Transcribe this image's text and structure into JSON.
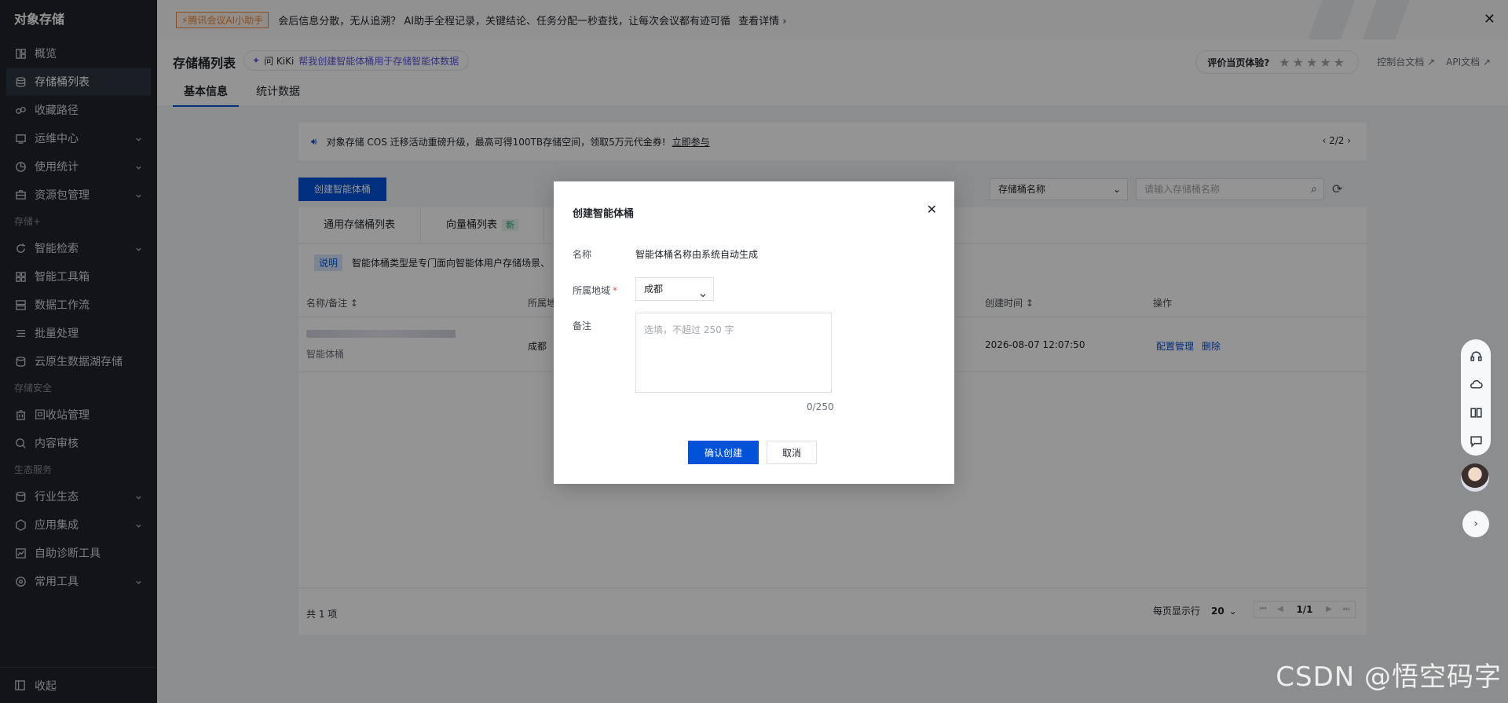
{
  "sidebar": {
    "brand": "对象存储",
    "items": [
      {
        "label": "概览",
        "icon": "overview-icon",
        "chevron": false
      },
      {
        "label": "存储桶列表",
        "icon": "bucket-icon",
        "chevron": false,
        "active": true
      },
      {
        "label": "收藏路径",
        "icon": "link-icon",
        "chevron": false
      },
      {
        "label": "运维中心",
        "icon": "monitor-icon",
        "chevron": true
      },
      {
        "label": "使用统计",
        "icon": "stats-icon",
        "chevron": true
      },
      {
        "label": "资源包管理",
        "icon": "package-icon",
        "chevron": true
      }
    ],
    "group2": "存储+",
    "items2": [
      {
        "label": "智能检索",
        "icon": "search-refresh-icon",
        "chevron": true
      },
      {
        "label": "智能工具箱",
        "icon": "toolbox-icon",
        "chevron": false
      },
      {
        "label": "数据工作流",
        "icon": "workflow-icon",
        "chevron": false
      },
      {
        "label": "批量处理",
        "icon": "list-icon",
        "chevron": false
      },
      {
        "label": "云原生数据湖存储",
        "icon": "datalake-icon",
        "chevron": false
      }
    ],
    "group3": "存储安全",
    "items3": [
      {
        "label": "回收站管理",
        "icon": "trash-icon",
        "chevron": false
      },
      {
        "label": "内容审核",
        "icon": "audit-icon",
        "chevron": false
      }
    ],
    "group4": "生态服务",
    "items4": [
      {
        "label": "行业生态",
        "icon": "ecosystem-icon",
        "chevron": true
      },
      {
        "label": "应用集成",
        "icon": "integration-icon",
        "chevron": true
      },
      {
        "label": "自助诊断工具",
        "icon": "diagnose-icon",
        "chevron": false
      },
      {
        "label": "常用工具",
        "icon": "tools-icon",
        "chevron": true
      }
    ],
    "collapse": "收起"
  },
  "banner": {
    "badge": "⚡腾讯会议AI小助手",
    "text": "会后信息分散，无从追溯？ AI助手全程记录，关键结论、任务分配一秒查找，让每次会议都有迹可循",
    "detail": "查看详情 ›",
    "close": "✕"
  },
  "header": {
    "title": "存储桶列表",
    "kiki_ask": "问 KiKi",
    "kiki_link": "帮我创建智能体桶用于存储智能体数据",
    "rate_label": "评价当页体验?",
    "stars": "★★★★★",
    "doc1": "控制台文档 ↗",
    "doc2": "API文档 ↗",
    "tabs": [
      "基本信息",
      "统计数据"
    ]
  },
  "notice": {
    "text": "对象存储 COS 迁移活动重磅升级，最高可得100TB存储空间，领取5万元代金券!",
    "join": "立即参与",
    "pager": "‹   2/2   ›"
  },
  "toolbar": {
    "create": "创建智能体桶",
    "select": "存储桶名称",
    "search_placeholder": "请输入存储桶名称"
  },
  "table": {
    "subtabs": [
      "通用存储桶列表",
      "向量桶列表"
    ],
    "new_badge": "新",
    "tip_label": "说明",
    "tip_text": "智能体桶类型是专门面向智能体用户存储场景、",
    "headers": {
      "name": "名称/备注 ↕",
      "region": "所属地",
      "created": "创建时间 ↕",
      "ops": "操作"
    },
    "row": {
      "remark": "智能体桶",
      "region": "成都",
      "created": "2026-08-07 12:07:50",
      "op1": "配置管理",
      "op2": "删除"
    },
    "total": "共 1 项",
    "per_page_label": "每页显示行",
    "per_page": "20",
    "page": "1/1"
  },
  "dialog": {
    "title": "创建智能体桶",
    "name_label": "名称",
    "name_value": "智能体桶名称由系统自动生成",
    "region_label": "所属地域",
    "region_value": "成都",
    "remark_label": "备注",
    "remark_placeholder": "选填，不超过 250 字",
    "counter": "0/250",
    "ok": "确认创建",
    "cancel": "取消"
  },
  "watermark": "CSDN @悟空码字",
  "colors": {
    "primary": "#0052d9",
    "sidebar": "#1f2329",
    "badge": "#e8893b"
  }
}
